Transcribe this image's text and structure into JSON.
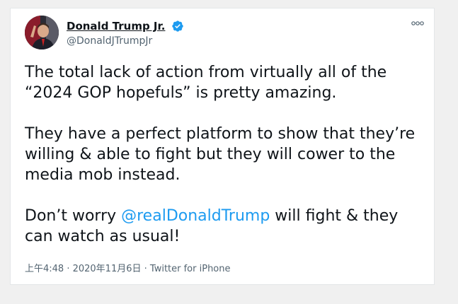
{
  "tweet": {
    "display_name": "Donald Trump Jr.",
    "handle": "@DonaldJTrumpJr",
    "paragraph1": "The total lack of action from virtually all of the “2024 GOP hopefuls” is pretty amazing.",
    "paragraph2": "They have a perfect platform to show that they’re willing & able to fight but they will cower to the media mob instead.",
    "paragraph3_before": "Don’t worry ",
    "mention": "@realDonaldTrump",
    "paragraph3_after": " will fight & they can watch as usual!",
    "timestamp": "上午4:48 · 2020年11月6日",
    "separator": " · ",
    "source": "Twitter for iPhone"
  },
  "icons": {
    "verified": "verified-badge-icon",
    "more": "more-options-icon"
  },
  "colors": {
    "mention": "#1d9bf0",
    "verified": "#1d9bf0",
    "text": "#0f1419",
    "secondary": "#536471"
  }
}
